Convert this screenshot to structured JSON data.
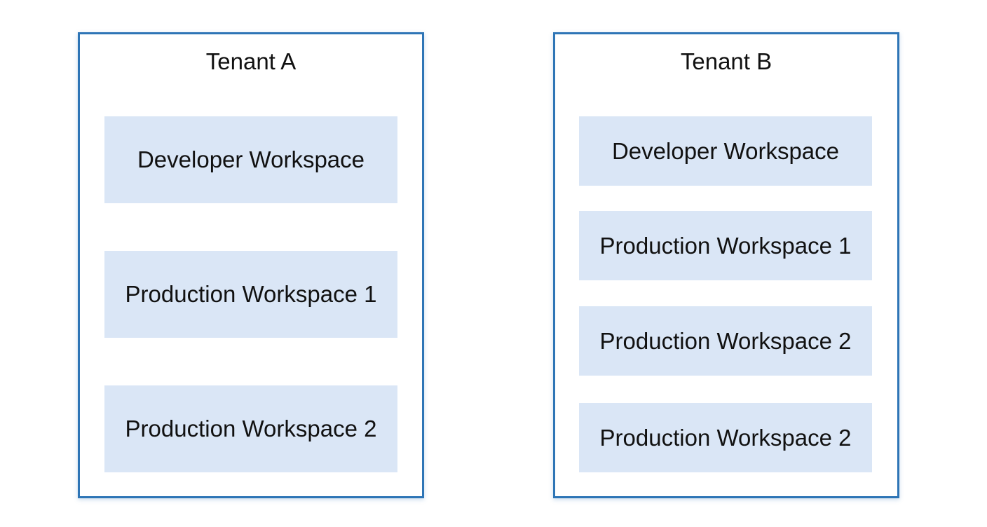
{
  "tenants": [
    {
      "title": "Tenant A",
      "workspaces": [
        "Developer Workspace",
        "Production Workspace 1",
        "Production Workspace 2"
      ]
    },
    {
      "title": "Tenant B",
      "workspaces": [
        "Developer Workspace",
        "Production Workspace 1",
        "Production Workspace 2",
        "Production Workspace 2"
      ]
    }
  ],
  "colors": {
    "tenant_border": "#2e75b6",
    "workspace_fill": "#dae6f6",
    "text": "#111111",
    "background": "#ffffff"
  }
}
